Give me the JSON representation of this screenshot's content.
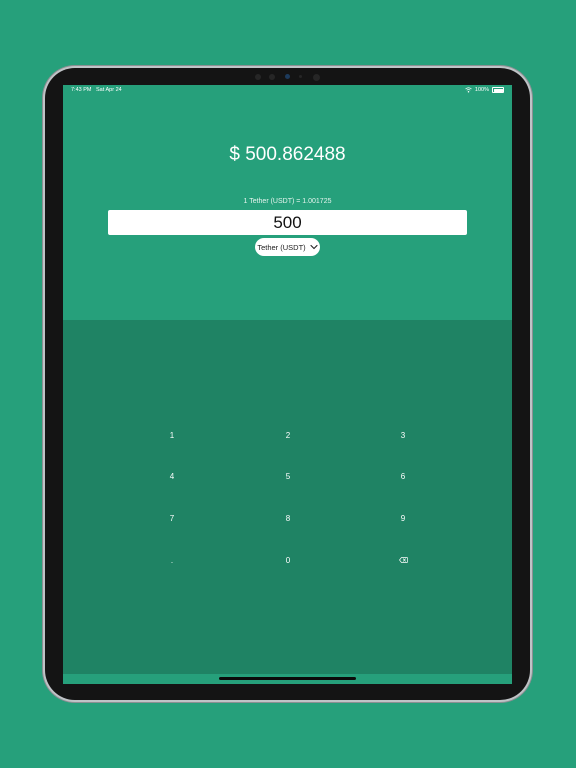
{
  "status_bar": {
    "time": "7:43 PM",
    "date": "Sat Apr 24",
    "battery": "100%"
  },
  "converter": {
    "result": "$ 500.862488",
    "rate": "1 Tether (USDT) = 1.001725",
    "amount": "500",
    "currency": "Tether (USDT)"
  },
  "keypad": {
    "keys": [
      "1",
      "2",
      "3",
      "4",
      "5",
      "6",
      "7",
      "8",
      "9",
      ".",
      "0"
    ],
    "backspace_icon": "backspace-icon"
  },
  "colors": {
    "background": "#26a07b",
    "keypad_background": "#1f8364",
    "text": "#ffffff"
  }
}
